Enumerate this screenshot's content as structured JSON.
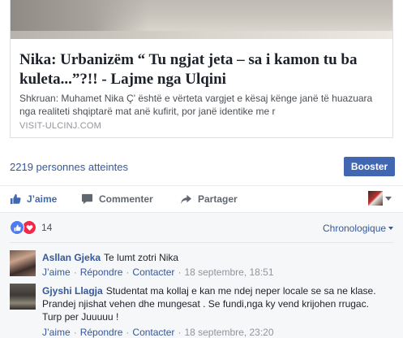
{
  "link_preview": {
    "title": "Nika: Urbanizëm “ Tu ngjat jeta – sa i kamon tu ba kuleta...”?!! - Lajme nga Ulqini",
    "description": "Shkruan: Muhamet Nika Ç' është e vërteta vargjet e kësaj kënge janë të huazuara nga realiteti shqiptarë mat anë kufirit, por janë identike me r",
    "domain": "VISIT-ULCINJ.COM"
  },
  "reach": {
    "text": "2219 personnes atteintes",
    "boost_label": "Booster"
  },
  "actions": {
    "like": "J’aime",
    "comment": "Commenter",
    "share": "Partager"
  },
  "reactions": {
    "count": "14",
    "types": [
      "like",
      "love"
    ]
  },
  "sort": {
    "label": "Chronologique"
  },
  "comments": [
    {
      "author": "Asllan Gjeka",
      "text": "Te lumt zotri Nika",
      "like": "J’aime",
      "reply": "Répondre",
      "contact": "Contacter",
      "time": "18 septembre, 18:51"
    },
    {
      "author": "Gjyshi Llagja",
      "text": "Studentat ma kollaj e kan me ndej neper locale se sa ne klase. Prandej njishat vehen dhe mungesat . Se fundi,nga ky vend krijohen rrugac. Turp per Juuuuu !",
      "like": "J’aime",
      "reply": "Répondre",
      "contact": "Contacter",
      "time": "18 septembre, 23:20"
    }
  ],
  "colors": {
    "link_blue": "#365899",
    "button_blue": "#4267b2",
    "meta_gray": "#90949c",
    "love_red": "#f0284a",
    "like_blue": "#4f7df0"
  },
  "icons": {
    "like": "thumbs-up-icon",
    "comment": "speech-bubble-icon",
    "share": "share-arrow-icon",
    "love": "heart-icon"
  }
}
